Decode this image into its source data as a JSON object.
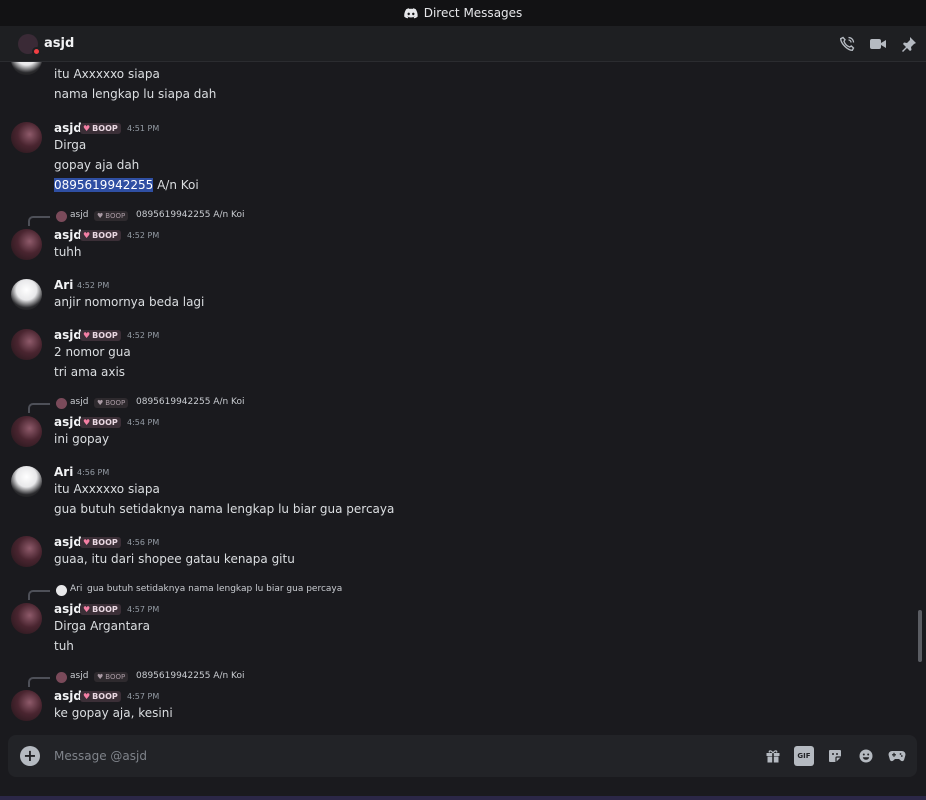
{
  "window": {
    "title": "Direct Messages"
  },
  "header": {
    "name": "asjd"
  },
  "badge_label": "BOOP",
  "messages": [
    {
      "lines": [
        "itu Axxxxxo siapa",
        "nama lengkap lu siapa dah"
      ]
    },
    {
      "user": "asjd",
      "time": "4:51 PM",
      "lines": [
        "Dirga",
        "gopay aja dah"
      ],
      "highlight": "0895619942255",
      "rest": " A/n Koi"
    },
    {
      "reply": {
        "user": "asjd",
        "text": "0895619942255 A/n Koi"
      },
      "user": "asjd",
      "time": "4:52 PM",
      "lines": [
        "tuhh"
      ]
    },
    {
      "user": "Ari",
      "time": "4:52 PM",
      "lines": [
        "anjir nomornya beda lagi"
      ]
    },
    {
      "user": "asjd",
      "time": "4:52 PM",
      "lines": [
        "2 nomor gua",
        "tri ama axis"
      ]
    },
    {
      "reply": {
        "user": "asjd",
        "text": "0895619942255 A/n Koi"
      },
      "user": "asjd",
      "time": "4:54 PM",
      "lines": [
        "ini gopay"
      ]
    },
    {
      "user": "Ari",
      "time": "4:56 PM",
      "lines": [
        "itu Axxxxxo siapa",
        "gua butuh setidaknya nama lengkap lu biar gua percaya"
      ]
    },
    {
      "user": "asjd",
      "time": "4:56 PM",
      "lines": [
        "guaa, itu dari shopee gatau kenapa gitu"
      ]
    },
    {
      "reply": {
        "user": "Ari",
        "text": "gua butuh setidaknya nama lengkap lu biar gua percaya"
      },
      "user": "asjd",
      "time": "4:57 PM",
      "lines": [
        "Dirga Argantara",
        "tuh"
      ]
    },
    {
      "reply": {
        "user": "asjd",
        "text": "0895619942255 A/n Koi"
      },
      "user": "asjd",
      "time": "4:57 PM",
      "lines": [
        "ke gopay aja, kesini"
      ]
    }
  ],
  "composer": {
    "placeholder": "Message @asjd"
  },
  "icons": {
    "header": [
      "phone-call-icon",
      "video-call-icon",
      "pin-icon"
    ],
    "composer": [
      "gift-icon",
      "gif-icon",
      "sticker-icon",
      "emoji-icon",
      "activities-icon"
    ]
  },
  "colors": {
    "background": "#1a1a1e",
    "highlight": "#2f4fa3",
    "dnd": "#f23f43",
    "badge_heart": "#f47fa4"
  }
}
